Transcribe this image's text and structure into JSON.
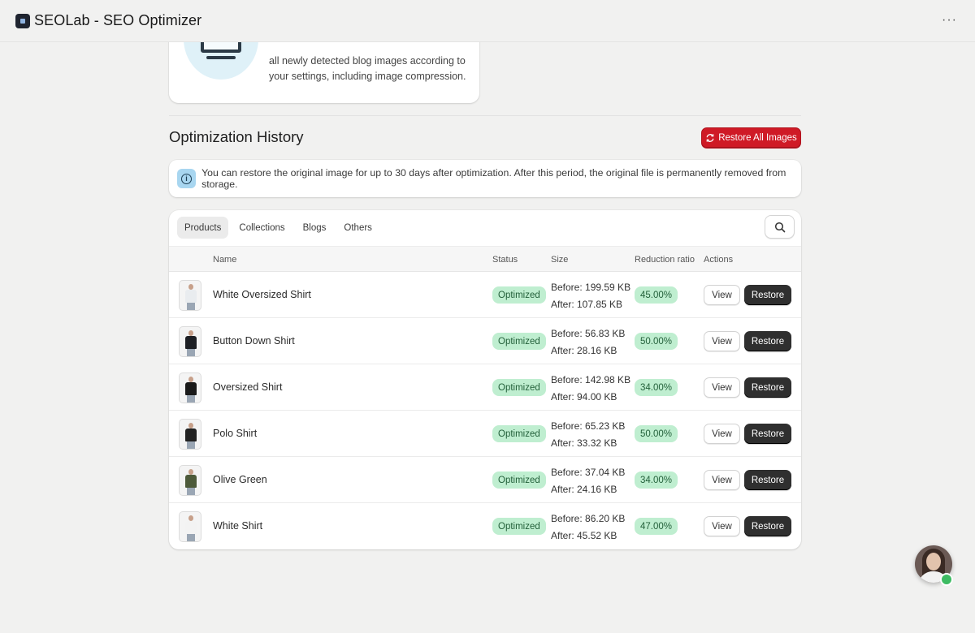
{
  "app": {
    "title": "SEOLab - SEO Optimizer",
    "more_label": "···",
    "logo_icon": "seolab-logo-icon"
  },
  "intro_card": {
    "text": "all newly detected blog images according to your settings, including image compression.",
    "illustration_icon": "monitor-icon"
  },
  "history": {
    "title": "Optimization History",
    "restore_all_label": "Restore All Images",
    "restore_all_icon": "refresh-icon",
    "restore_all_color": "#cf1a26",
    "banner_text": "You can restore the original image for up to 30 days after optimization. After this period, the original file is permanently removed from storage.",
    "banner_icon": "info-icon"
  },
  "tabs": [
    {
      "label": "Products",
      "active": true
    },
    {
      "label": "Collections",
      "active": false
    },
    {
      "label": "Blogs",
      "active": false
    },
    {
      "label": "Others",
      "active": false
    }
  ],
  "table": {
    "columns": {
      "name": "Name",
      "status": "Status",
      "size": "Size",
      "ratio": "Reduction ratio",
      "actions": "Actions"
    },
    "rows": [
      {
        "name": "White Oversized Shirt",
        "status": "Optimized",
        "before": "Before: 199.59 KB",
        "after": "After: 107.85 KB",
        "ratio": "45.00%",
        "view": "View",
        "restore": "Restore",
        "shirt_color": "#e9ecef"
      },
      {
        "name": "Button Down Shirt",
        "status": "Optimized",
        "before": "Before: 56.83 KB",
        "after": "After: 28.16 KB",
        "ratio": "50.00%",
        "view": "View",
        "restore": "Restore",
        "shirt_color": "#1d1f24"
      },
      {
        "name": "Oversized Shirt",
        "status": "Optimized",
        "before": "Before: 142.98 KB",
        "after": "After: 94.00 KB",
        "ratio": "34.00%",
        "view": "View",
        "restore": "Restore",
        "shirt_color": "#1a1a1a"
      },
      {
        "name": "Polo Shirt",
        "status": "Optimized",
        "before": "Before: 65.23 KB",
        "after": "After: 33.32 KB",
        "ratio": "50.00%",
        "view": "View",
        "restore": "Restore",
        "shirt_color": "#222222"
      },
      {
        "name": "Olive Green",
        "status": "Optimized",
        "before": "Before: 37.04 KB",
        "after": "After: 24.16 KB",
        "ratio": "34.00%",
        "view": "View",
        "restore": "Restore",
        "shirt_color": "#4d5a3a"
      },
      {
        "name": "White Shirt",
        "status": "Optimized",
        "before": "Before: 86.20 KB",
        "after": "After: 45.52 KB",
        "ratio": "47.00%",
        "view": "View",
        "restore": "Restore",
        "shirt_color": "#f3f3f3"
      }
    ]
  },
  "search_icon": "search-icon",
  "chat": {
    "avatar_icon": "support-avatar",
    "status_color": "#3dbb62"
  }
}
